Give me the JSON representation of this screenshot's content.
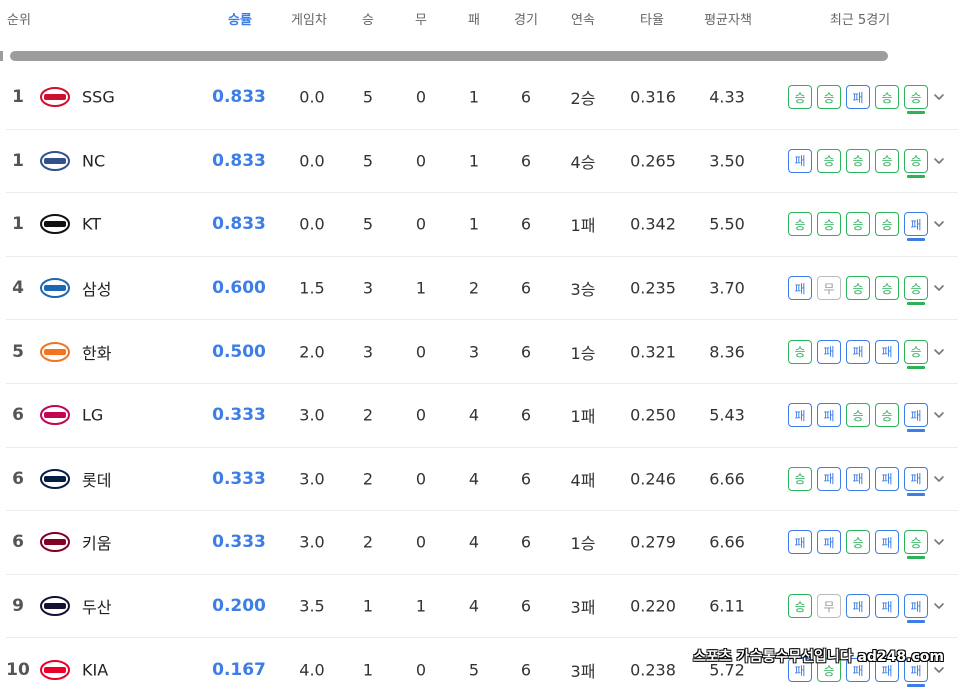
{
  "header": {
    "rank": "순위",
    "pct": "승률",
    "gb": "게임차",
    "w": "승",
    "d": "무",
    "l": "패",
    "g": "경기",
    "streak": "연속",
    "avg": "타율",
    "era": "평균자책",
    "recent": "최근 5경기"
  },
  "rows": [
    {
      "rank": "1",
      "team": "SSG",
      "pct": "0.833",
      "gb": "0.0",
      "w": "5",
      "d": "0",
      "l": "1",
      "g": "6",
      "streak": "2승",
      "avg": "0.316",
      "era": "4.33",
      "recent": [
        "승",
        "승",
        "패",
        "승",
        "승"
      ],
      "logo_color": "#ce0e2d"
    },
    {
      "rank": "1",
      "team": "NC",
      "pct": "0.833",
      "gb": "0.0",
      "w": "5",
      "d": "0",
      "l": "1",
      "g": "6",
      "streak": "4승",
      "avg": "0.265",
      "era": "3.50",
      "recent": [
        "패",
        "승",
        "승",
        "승",
        "승"
      ],
      "logo_color": "#315288"
    },
    {
      "rank": "1",
      "team": "KT",
      "pct": "0.833",
      "gb": "0.0",
      "w": "5",
      "d": "0",
      "l": "1",
      "g": "6",
      "streak": "1패",
      "avg": "0.342",
      "era": "5.50",
      "recent": [
        "승",
        "승",
        "승",
        "승",
        "패"
      ],
      "logo_color": "#111111"
    },
    {
      "rank": "4",
      "team": "삼성",
      "pct": "0.600",
      "gb": "1.5",
      "w": "3",
      "d": "1",
      "l": "2",
      "g": "6",
      "streak": "3승",
      "avg": "0.235",
      "era": "3.70",
      "recent": [
        "패",
        "무",
        "승",
        "승",
        "승"
      ],
      "logo_color": "#1d66b3"
    },
    {
      "rank": "5",
      "team": "한화",
      "pct": "0.500",
      "gb": "2.0",
      "w": "3",
      "d": "0",
      "l": "3",
      "g": "6",
      "streak": "1승",
      "avg": "0.321",
      "era": "8.36",
      "recent": [
        "승",
        "패",
        "패",
        "패",
        "승"
      ],
      "logo_color": "#f37321"
    },
    {
      "rank": "6",
      "team": "LG",
      "pct": "0.333",
      "gb": "3.0",
      "w": "2",
      "d": "0",
      "l": "4",
      "g": "6",
      "streak": "1패",
      "avg": "0.250",
      "era": "5.43",
      "recent": [
        "패",
        "패",
        "승",
        "승",
        "패"
      ],
      "logo_color": "#c30452"
    },
    {
      "rank": "6",
      "team": "롯데",
      "pct": "0.333",
      "gb": "3.0",
      "w": "2",
      "d": "0",
      "l": "4",
      "g": "6",
      "streak": "4패",
      "avg": "0.246",
      "era": "6.66",
      "recent": [
        "승",
        "패",
        "패",
        "패",
        "패"
      ],
      "logo_color": "#041e42"
    },
    {
      "rank": "6",
      "team": "키움",
      "pct": "0.333",
      "gb": "3.0",
      "w": "2",
      "d": "0",
      "l": "4",
      "g": "6",
      "streak": "1승",
      "avg": "0.279",
      "era": "6.66",
      "recent": [
        "패",
        "패",
        "승",
        "패",
        "승"
      ],
      "logo_color": "#820024"
    },
    {
      "rank": "9",
      "team": "두산",
      "pct": "0.200",
      "gb": "3.5",
      "w": "1",
      "d": "1",
      "l": "4",
      "g": "6",
      "streak": "3패",
      "avg": "0.220",
      "era": "6.11",
      "recent": [
        "승",
        "무",
        "패",
        "패",
        "패"
      ],
      "logo_color": "#131230"
    },
    {
      "rank": "10",
      "team": "KIA",
      "pct": "0.167",
      "gb": "4.0",
      "w": "1",
      "d": "0",
      "l": "5",
      "g": "6",
      "streak": "3패",
      "avg": "0.238",
      "era": "5.72",
      "recent": [
        "패",
        "승",
        "패",
        "패",
        "패"
      ],
      "logo_color": "#ea0029"
    }
  ],
  "watermark": "스포츠 가슴통수무선입니다 ad248.com",
  "colors": {
    "accent": "#3d7ee6",
    "win": "#2bb35a",
    "loss": "#3d7ee6",
    "draw": "#999999"
  }
}
